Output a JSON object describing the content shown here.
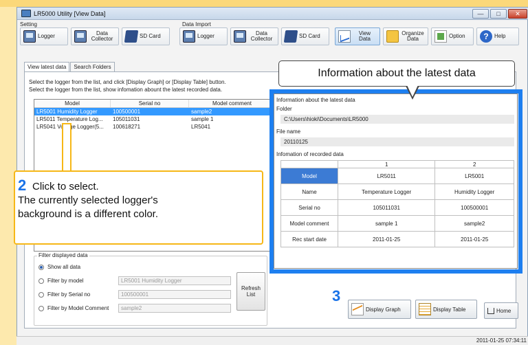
{
  "window": {
    "title": "LR5000 Utility [View Data]",
    "min_label": "—",
    "max_label": "□",
    "close_label": "✕"
  },
  "groups": {
    "setting": "Setting",
    "data_import": "Data Import"
  },
  "toolbar": {
    "logger": "Logger",
    "data_collector": "Data Collector",
    "sd_card": "SD Card",
    "import_logger": "Logger",
    "import_collector": "Data Collector",
    "import_sd_card": "SD Card",
    "view_data": "View Data",
    "organize_data": "Organize Data",
    "option": "Option",
    "help": "Help"
  },
  "tabs": [
    {
      "label": "View latest data"
    },
    {
      "label": "Search Folders"
    }
  ],
  "instructions": [
    "Select the logger from the list, and click [Display Graph] or [Display Table] button.",
    "Select the logger from the list, show infomation abount the latest recorded data."
  ],
  "list": {
    "headers": [
      "Model",
      "Serial no",
      "Model comment"
    ],
    "rows": [
      {
        "model": "LR5001 Humidity Logger",
        "serial": "100500001",
        "comment": "sample2"
      },
      {
        "model": "LR5011 Temperature Log...",
        "serial": "105011031",
        "comment": "sample 1"
      },
      {
        "model": "LR5041 Voltage Logger(5...",
        "serial": "100618271",
        "comment": "LR5041"
      }
    ]
  },
  "filter": {
    "legend": "Filter displayed data",
    "show_all": "Show all data",
    "by_model": "Filter by model",
    "by_serial": "Filter by Serial no",
    "by_comment": "Filter by Model Comment",
    "model_value": "LR5001 Humidity Logger",
    "serial_value": "100500001",
    "comment_value": "sample2",
    "refresh": "Refresh List"
  },
  "info": {
    "heading": "Information about the latest data",
    "folder_label": "Folder",
    "folder_value": "C:\\Users\\hioki\\Documents\\LR5000",
    "file_label": "File name",
    "file_value": "20110125",
    "recorded_label": "Infomation of recorded data",
    "col_headers": [
      "1",
      "2"
    ],
    "rows": [
      {
        "label": "Model",
        "v1": "LR5011",
        "v2": "LR5001"
      },
      {
        "label": "Name",
        "v1": "Temperature Logger",
        "v2": "Humidity Logger"
      },
      {
        "label": "Serial no",
        "v1": "105011031",
        "v2": "100500001"
      },
      {
        "label": "Model comment",
        "v1": "sample 1",
        "v2": "sample2"
      },
      {
        "label": "Rec start date",
        "v1": "2011-01-25",
        "v2": "2011-01-25"
      }
    ]
  },
  "callouts": {
    "info_title": "Information about the latest data",
    "step2_num": "2",
    "step2_line1": "Click to select.",
    "step2_line2": "The currently selected logger's",
    "step2_line3": "background is a different color.",
    "step3_num": "3"
  },
  "bottom": {
    "display_graph": "Display Graph",
    "display_table": "Display Table",
    "home": "Home"
  },
  "status": {
    "timestamp": "2011-01-25 07:34:11"
  },
  "colors": {
    "accent_blue": "#1e7ff0",
    "callout_orange": "#f6b716",
    "selection": "#3399ff"
  }
}
